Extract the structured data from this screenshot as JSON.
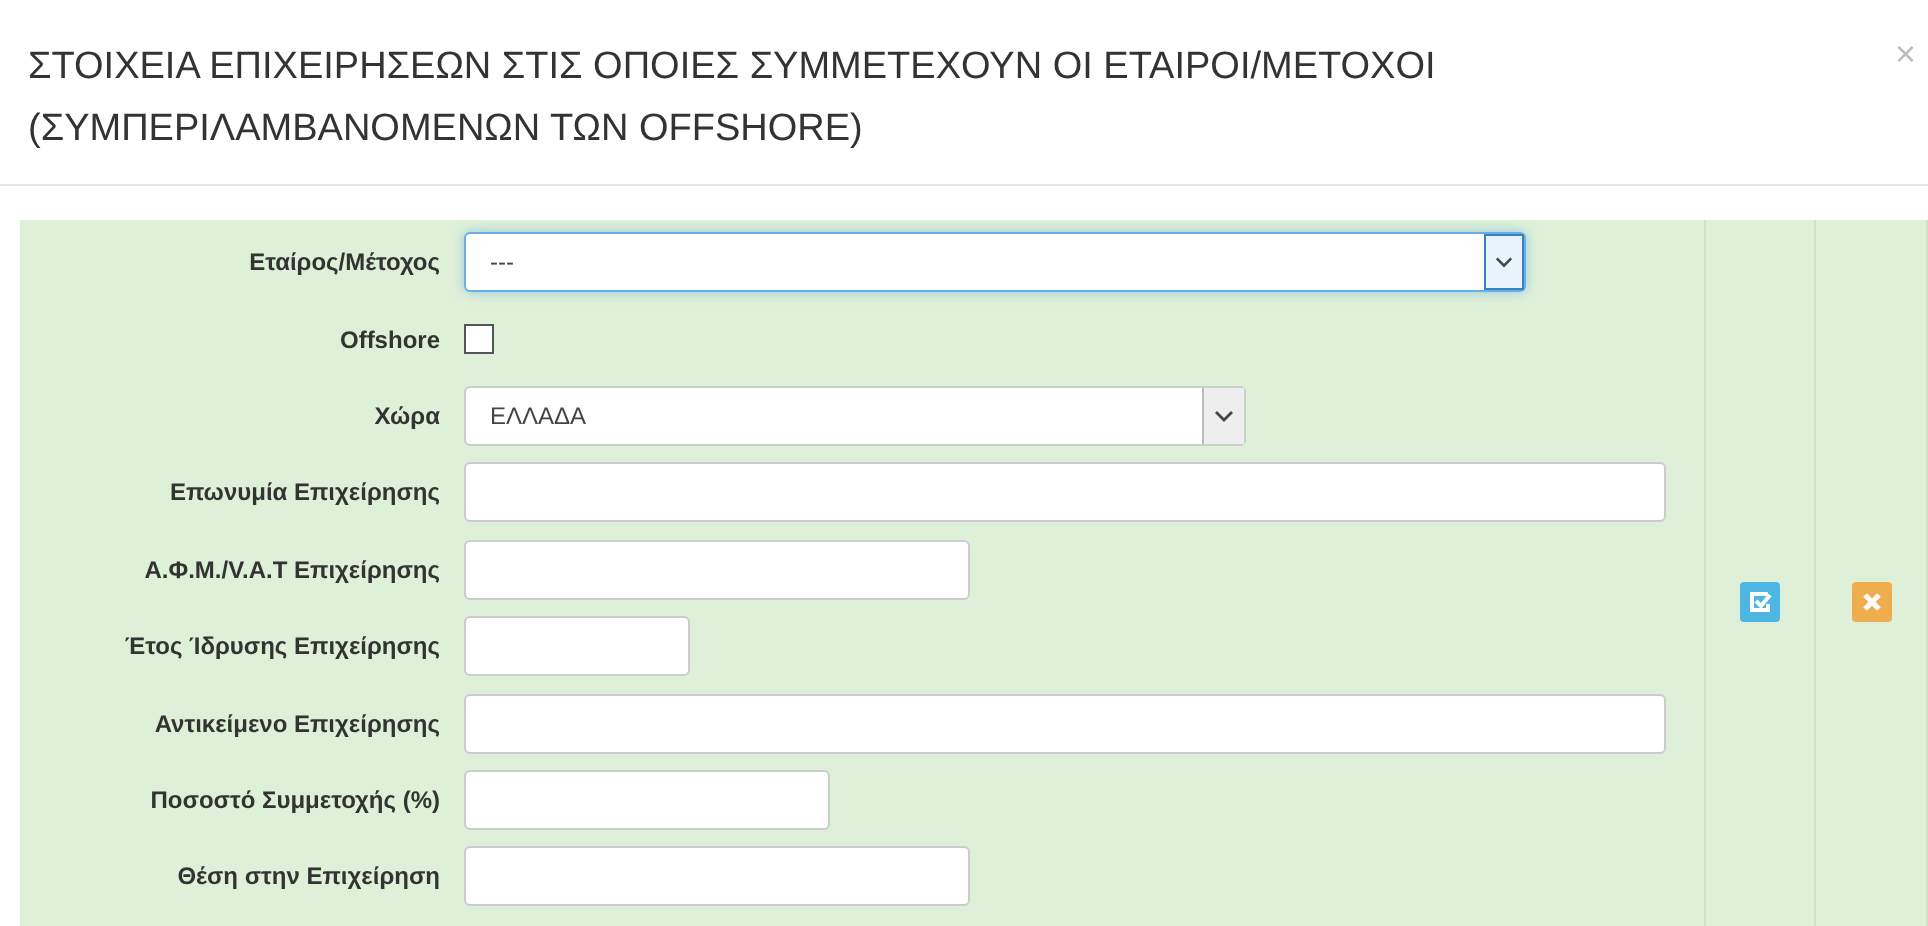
{
  "modal": {
    "title": "ΣΤΟΙΧΕΙΑ ΕΠΙΧΕΙΡΗΣΕΩΝ ΣΤΙΣ ΟΠΟΙΕΣ ΣΥΜΜΕΤΕΧΟΥΝ ΟΙ ΕΤΑΙΡΟΙ/ΜΕΤΟΧΟΙ (ΣΥΜΠΕΡΙΛΑΜΒΑΝΟΜΕΝΩΝ ΤΩΝ OFFSHORE)",
    "close": "×"
  },
  "fields": [
    {
      "label": "Εταίρος/Μέτοχος",
      "kind": "select",
      "value": "---",
      "focused": true
    },
    {
      "label": "Offshore",
      "kind": "checkbox",
      "checked": false
    },
    {
      "label": "Χώρα",
      "kind": "select",
      "value": "ΕΛΛΑΔΑ",
      "focused": false
    },
    {
      "label": "Επωνυμία Επιχείρησης",
      "kind": "text"
    },
    {
      "label": "Α.Φ.Μ./V.A.T Επιχείρησης",
      "kind": "text"
    },
    {
      "label": "Έτος Ίδρυσης Επιχείρησης",
      "kind": "text"
    },
    {
      "label": "Αντικείμενο Επιχείρησης",
      "kind": "text"
    },
    {
      "label": "Ποσοστό Συμμετοχής (%)",
      "kind": "text"
    },
    {
      "label": "Θέση στην Επιχείρηση",
      "kind": "text"
    }
  ]
}
